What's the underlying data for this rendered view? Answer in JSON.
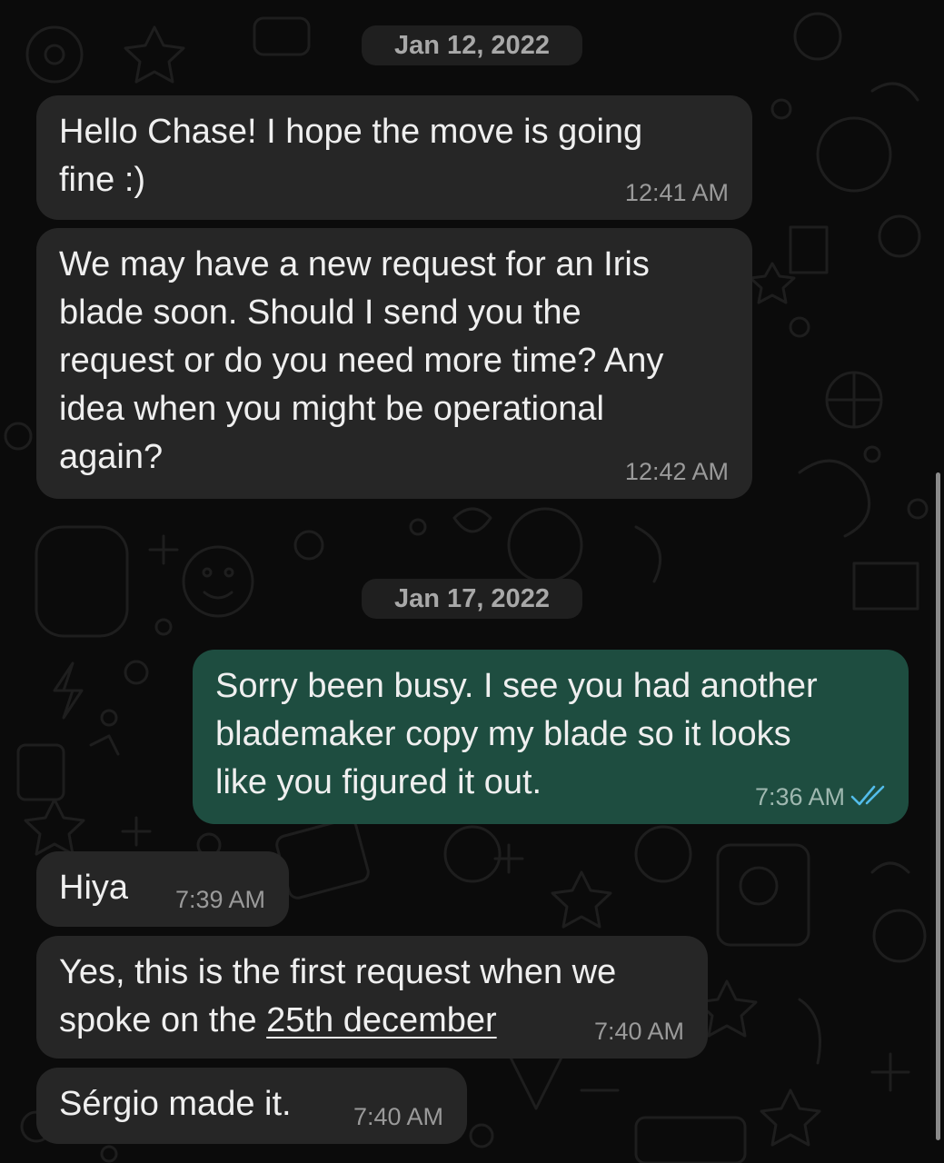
{
  "chat": {
    "dates": [
      "Jan 12, 2022",
      "Jan 17, 2022"
    ],
    "messages": [
      {
        "lines": [
          "Hello Chase! I hope the move is going",
          "fine :)"
        ],
        "time": "12:41 AM",
        "direction": "incoming"
      },
      {
        "lines": [
          "We may have a new request for an Iris",
          "blade soon. Should I send you the",
          "request or do you need more time? Any",
          "idea when you might be operational",
          "again?"
        ],
        "time": "12:42 AM",
        "direction": "incoming"
      },
      {
        "lines": [
          "Sorry been busy. I see you had another",
          "blademaker copy my blade so it looks",
          "like you figured it out."
        ],
        "time": "7:36 AM",
        "direction": "outgoing",
        "status": "read"
      },
      {
        "lines": [
          "Hiya"
        ],
        "time": "7:39 AM",
        "direction": "incoming"
      },
      {
        "line1": "Yes, this is the first request when we",
        "line2_prefix": "spoke on the ",
        "line2_link": "25th december",
        "time": "7:40 AM",
        "direction": "incoming"
      },
      {
        "lines": [
          "Sérgio made it."
        ],
        "time": "7:40 AM",
        "direction": "incoming"
      }
    ]
  },
  "icons": {
    "read_receipt": "double-check-icon",
    "wallpaper": "doodle-pattern"
  },
  "colors": {
    "background": "#0b0b0b",
    "incoming_bubble": "#262626",
    "outgoing_bubble": "#1e4d40",
    "read_tick": "#53bdeb",
    "date_pill": "#1f1f1f"
  }
}
